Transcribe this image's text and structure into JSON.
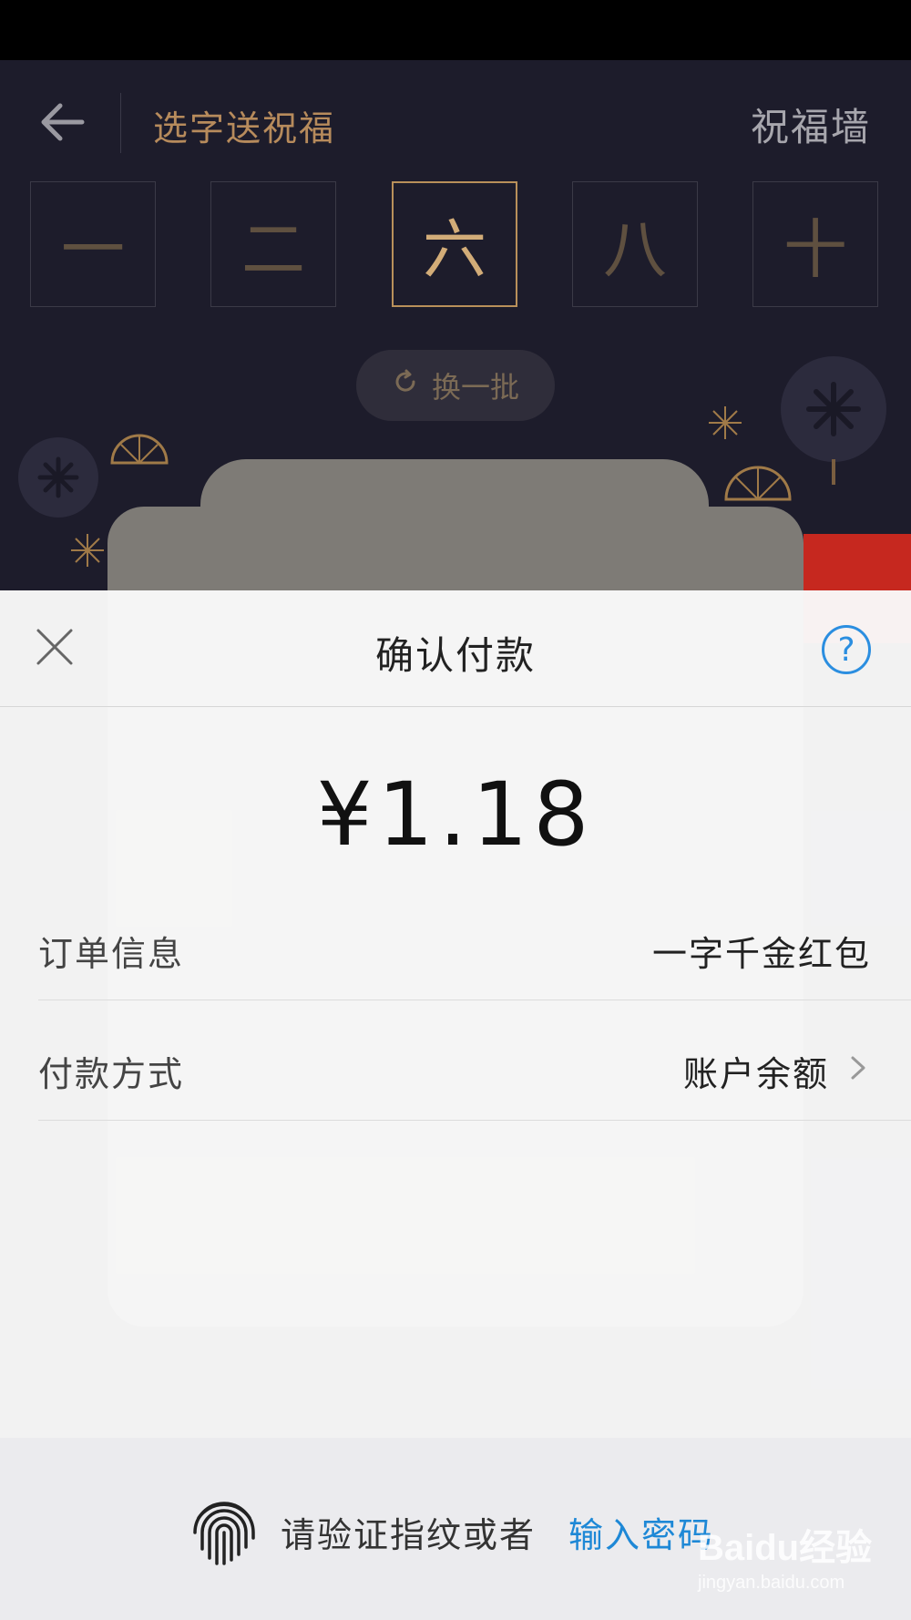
{
  "background_screen": {
    "nav": {
      "title": "选字送祝福",
      "right_link": "祝福墙"
    },
    "characters": [
      {
        "char": "一",
        "selected": false
      },
      {
        "char": "二",
        "selected": false
      },
      {
        "char": "六",
        "selected": true
      },
      {
        "char": "八",
        "selected": false
      },
      {
        "char": "十",
        "selected": false
      }
    ],
    "refresh_button_label": "换一批"
  },
  "payment_sheet": {
    "title": "确认付款",
    "amount": "¥1.18",
    "rows": [
      {
        "label": "订单信息",
        "value": "一字千金红包"
      },
      {
        "label": "付款方式",
        "value": "账户余额"
      }
    ]
  },
  "bottom_bar": {
    "prompt_text": "请验证指纹或者",
    "link_text": "输入密码"
  },
  "watermark": {
    "main": "Baidu经验",
    "sub": "jingyan.baidu.com"
  },
  "colors": {
    "accent_blue": "#1e88d6",
    "gold": "#b9905a",
    "dark_bg": "#1d1c2b"
  }
}
